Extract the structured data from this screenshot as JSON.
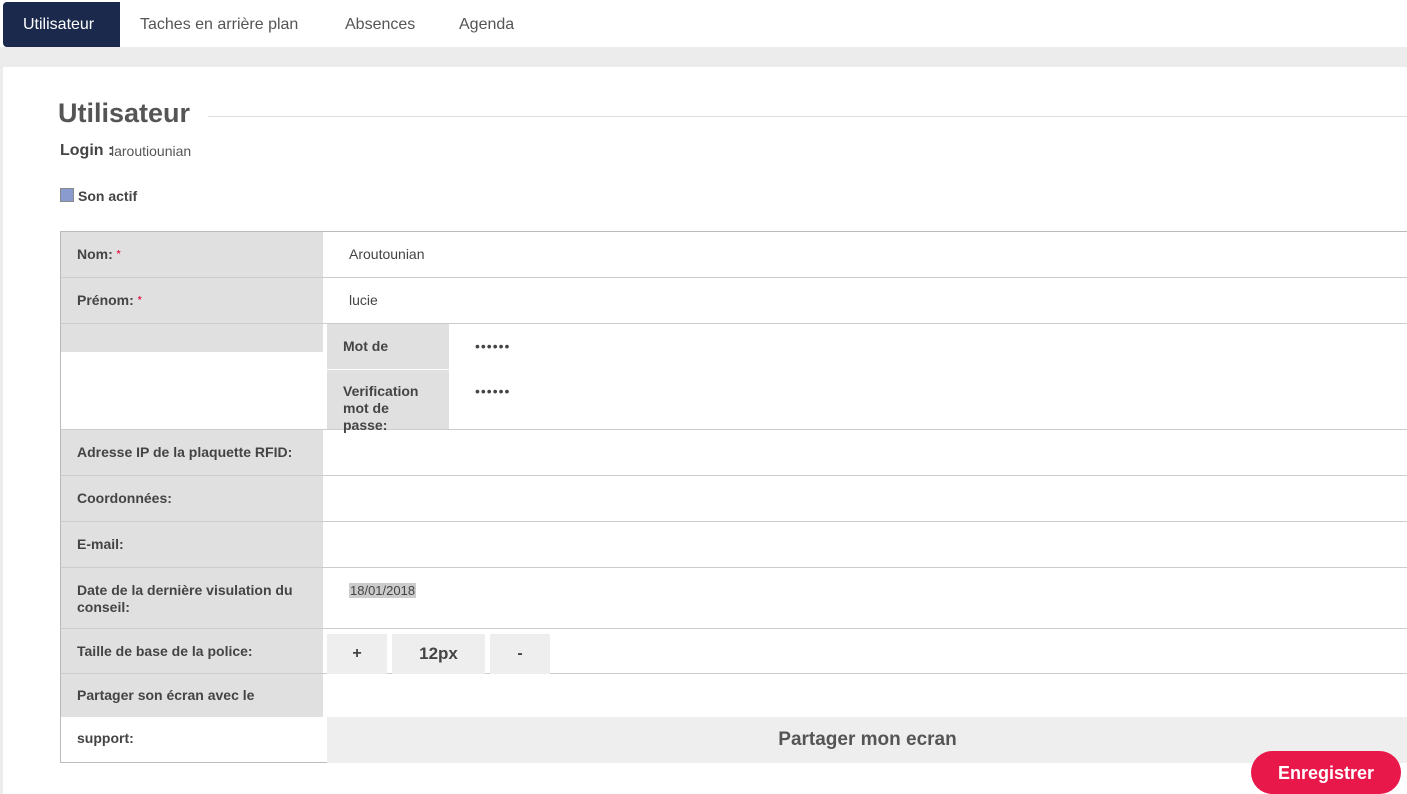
{
  "tabs": [
    {
      "label": "Utilisateur"
    },
    {
      "label": "Taches en arrière plan"
    },
    {
      "label": "Absences"
    },
    {
      "label": "Agenda"
    }
  ],
  "title": "Utilisateur",
  "login": {
    "label": "Login :",
    "value": "laroutiounian"
  },
  "active": {
    "label": "Son actif",
    "checked": true
  },
  "fields": {
    "nom": {
      "label": "Nom:",
      "value": "Aroutounian"
    },
    "prenom": {
      "label": "Prénom:",
      "value": "lucie"
    },
    "password": {
      "label": "Mot de passe:",
      "value": "••••••"
    },
    "password_verify": {
      "label_line1": "Verification",
      "label_line2": "mot de passe:",
      "value": "••••••"
    },
    "ip_rfid": {
      "label": "Adresse IP de la plaquette RFID:",
      "value": ""
    },
    "coordonnees": {
      "label": "Coordonnées:",
      "value": ""
    },
    "email": {
      "label": "E-mail:",
      "value": ""
    },
    "last_advice": {
      "label_line1": "Date de la dernière visulation du",
      "label_line2": "conseil:",
      "value": "18/01/2018"
    },
    "font_size": {
      "label": "Taille de base de la police:",
      "plus": "+",
      "value": "12px",
      "minus": "-"
    },
    "share": {
      "label": "Partager son écran avec le support:",
      "button": "Partager mon ecran"
    }
  },
  "required_mark": "*",
  "save_button": "Enregistrer",
  "colors": {
    "accent": "#1b2a4c",
    "save": "#e8184a",
    "required": "#e0244b"
  }
}
